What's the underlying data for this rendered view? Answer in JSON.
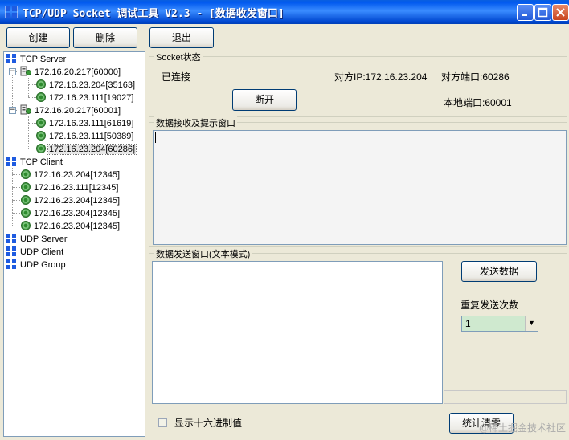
{
  "window": {
    "title": "TCP/UDP Socket 调试工具 V2.3 - [数据收发窗口]",
    "controls": [
      "minimize-icon",
      "maximize-icon",
      "close-icon"
    ]
  },
  "toolbar": {
    "create_label": "创建",
    "delete_label": "删除",
    "exit_label": "退出"
  },
  "tree": {
    "tcp_server_label": "TCP Server",
    "servers": [
      {
        "label": "172.16.20.217[60000]",
        "children": [
          "172.16.23.204[35163]",
          "172.16.23.111[19027]"
        ]
      },
      {
        "label": "172.16.20.217[60001]",
        "children": [
          "172.16.23.111[61619]",
          "172.16.23.111[50389]",
          "172.16.23.204[60286]"
        ]
      }
    ],
    "tcp_client_label": "TCP Client",
    "clients": [
      "172.16.23.204[12345]",
      "172.16.23.111[12345]",
      "172.16.23.204[12345]",
      "172.16.23.204[12345]",
      "172.16.23.204[12345]"
    ],
    "udp_server_label": "UDP Server",
    "udp_client_label": "UDP Client",
    "udp_group_label": "UDP Group"
  },
  "socket": {
    "group_title": "Socket状态",
    "status": "已连接",
    "peer_ip": "对方IP:172.16.23.204",
    "peer_port": "对方端口:60286",
    "local_port": "本地端口:60001",
    "disconnect_label": "断开"
  },
  "receive": {
    "group_title": "数据接收及提示窗口"
  },
  "send": {
    "group_title": "数据发送窗口(文本模式)",
    "send_label": "发送数据",
    "repeat_label": "重复发送次数",
    "repeat_value": "1"
  },
  "footer": {
    "hex_label": "显示十六进制值",
    "clear_label": "统计清零",
    "watermark": "@稀土掘金技术社区"
  }
}
